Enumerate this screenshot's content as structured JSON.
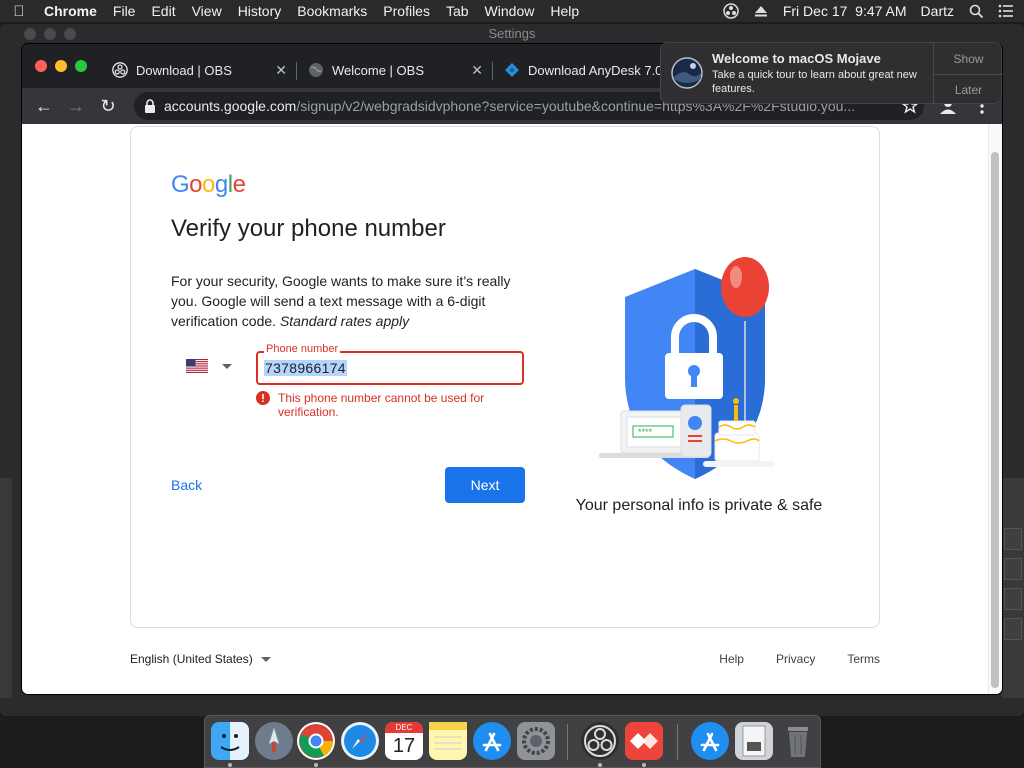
{
  "menubar": {
    "app_name": "Chrome",
    "items": [
      "File",
      "Edit",
      "View",
      "History",
      "Bookmarks",
      "Profiles",
      "Tab",
      "Window",
      "Help"
    ],
    "clock": "Fri Dec 17  9:47 AM",
    "user": "Dartz"
  },
  "background_window": {
    "title": "Settings"
  },
  "chrome": {
    "tabs": [
      {
        "title": "Download | OBS",
        "icon": "obs-icon"
      },
      {
        "title": "Welcome | OBS",
        "icon": "globe-icon"
      },
      {
        "title": "Download AnyDesk 7.0",
        "icon": "anydesk-icon"
      }
    ],
    "url_host": "accounts.google.com",
    "url_path": "/signup/v2/webgradsidvphone?service=youtube&continue=https%3A%2F%2Fstudio.you..."
  },
  "page": {
    "logo": [
      "G",
      "o",
      "o",
      "g",
      "l",
      "e"
    ],
    "logo_colors": [
      "#4285f4",
      "#ea4335",
      "#fbbc05",
      "#4285f4",
      "#34a853",
      "#ea4335"
    ],
    "title": "Verify your phone number",
    "description": "For your security, Google wants to make sure it’s really you. Google will send a text message with a 6-digit verification code.",
    "description_note": "Standard rates apply",
    "phone_label": "Phone number",
    "phone_value": "7378966174",
    "error_text": "This phone number cannot be used for verification.",
    "back_label": "Back",
    "next_label": "Next",
    "private_text": "Your personal info is private & safe",
    "illustration_code": "****"
  },
  "footer": {
    "language": "English (United States)",
    "links": [
      "Help",
      "Privacy",
      "Terms"
    ]
  },
  "notification": {
    "title": "Welcome to macOS Mojave",
    "body": "Take a quick tour to learn about great new features.",
    "show_label": "Show",
    "later_label": "Later"
  },
  "dock": {
    "items": [
      "finder",
      "launchpad",
      "chrome",
      "safari",
      "calendar",
      "notes",
      "app-store",
      "system-preferences",
      "obs",
      "anydesk",
      "app-store-downloads",
      "downloads-folder",
      "trash"
    ],
    "calendar_month": "DEC",
    "calendar_day": "17"
  }
}
